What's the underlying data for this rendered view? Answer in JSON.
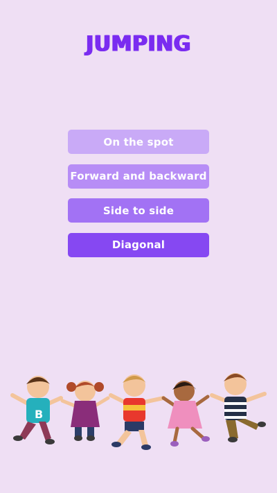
{
  "page": {
    "title": "JUMPING"
  },
  "menu": {
    "items": [
      {
        "label": "On the spot",
        "color": "#c9aaf7"
      },
      {
        "label": "Forward and backward",
        "color": "#b78df6"
      },
      {
        "label": "Side to side",
        "color": "#a272f4"
      },
      {
        "label": "Diagonal",
        "color": "#8648f2"
      }
    ]
  },
  "illustration": {
    "icon": "jumping-kids-illustration",
    "text_on_shirt": "B"
  }
}
